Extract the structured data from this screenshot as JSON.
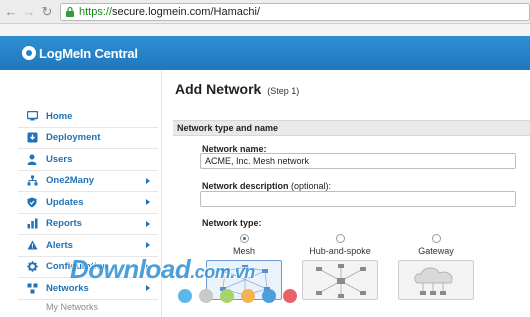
{
  "browser": {
    "url_secure": "https://",
    "url_rest": "secure.logmein.com/Hamachi/"
  },
  "app": {
    "brand": "LogMeIn Central"
  },
  "sidebar": {
    "items": [
      {
        "label": "Home",
        "icon": "monitor-icon",
        "has_arrow": false
      },
      {
        "label": "Deployment",
        "icon": "deployment-icon",
        "has_arrow": false
      },
      {
        "label": "Users",
        "icon": "user-icon",
        "has_arrow": false
      },
      {
        "label": "One2Many",
        "icon": "hierarchy-icon",
        "has_arrow": true
      },
      {
        "label": "Updates",
        "icon": "shield-icon",
        "has_arrow": true
      },
      {
        "label": "Reports",
        "icon": "bar-chart-icon",
        "has_arrow": true
      },
      {
        "label": "Alerts",
        "icon": "warning-icon",
        "has_arrow": true
      },
      {
        "label": "Configuration",
        "icon": "gear-icon",
        "has_arrow": true
      },
      {
        "label": "Networks",
        "icon": "network-icon",
        "has_arrow": true
      }
    ],
    "sub_item": "My Networks"
  },
  "main": {
    "title": "Add Network",
    "step": "(Step 1)",
    "section_title": "Network type and name",
    "name_label": "Network name:",
    "name_value": "ACME, Inc. Mesh network",
    "desc_label": "Network description",
    "desc_optional": "(optional):",
    "desc_value": "",
    "type_label": "Network type:",
    "types": [
      {
        "label": "Mesh",
        "selected": true
      },
      {
        "label": "Hub-and-spoke",
        "selected": false
      },
      {
        "label": "Gateway",
        "selected": false
      }
    ]
  },
  "watermark": {
    "text": "Download",
    "domain": ".com.vn",
    "dot_colors": [
      "#5bb8e8",
      "#c9c9c9",
      "#a6d46a",
      "#f4b350",
      "#4a9fdc",
      "#e8626a"
    ]
  },
  "colors": {
    "accent": "#1f77bd",
    "link": "#1f72b8"
  }
}
